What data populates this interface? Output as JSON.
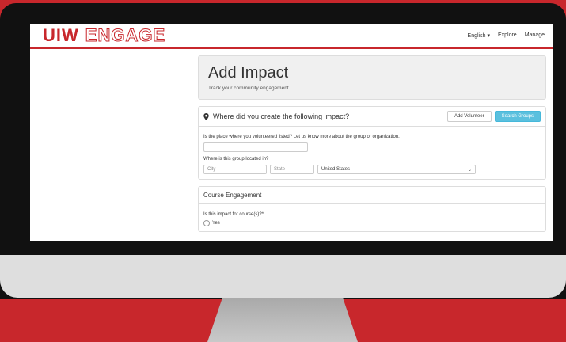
{
  "nav": {
    "logo_uiw": "UIW",
    "logo_engage": "ENGAGE",
    "language": "English ▾",
    "explore": "Explore",
    "manage": "Manage"
  },
  "header": {
    "title": "Add Impact",
    "subtitle": "Track your community engagement"
  },
  "location_panel": {
    "question": "Where did you create the following impact?",
    "add_volunteer_button": "Add Volunteer",
    "search_groups_button": "Search Groups",
    "place_label": "Is the place where you volunteered listed? Let us know more about the group or organization.",
    "group_location_label": "Where is this group located in?",
    "city_placeholder": "City",
    "state_placeholder": "State",
    "country_value": "United States"
  },
  "course_panel": {
    "title": "Course Engagement",
    "question": "Is this impact for course(s)?*",
    "option_yes": "Yes"
  },
  "colors": {
    "brand_red": "#c8272c",
    "info_blue": "#5bc0de"
  }
}
